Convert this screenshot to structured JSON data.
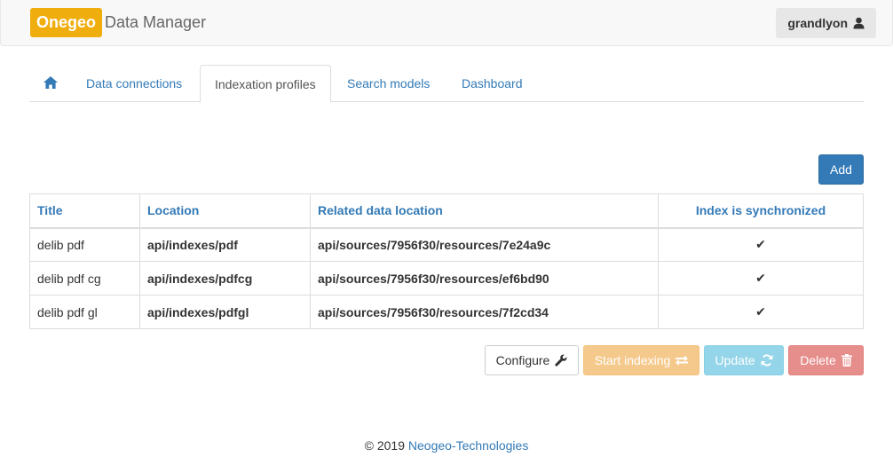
{
  "navbar": {
    "brand": "Onegeo",
    "app_title": "Data Manager",
    "user": "grandlyon",
    "user_icon": "user-icon"
  },
  "tabs": [
    {
      "label": "",
      "icon": "home-icon",
      "active": false
    },
    {
      "label": "Data connections",
      "active": false
    },
    {
      "label": "Indexation profiles",
      "active": true
    },
    {
      "label": "Search models",
      "active": false
    },
    {
      "label": "Dashboard",
      "active": false
    }
  ],
  "toolbar": {
    "add_label": "Add"
  },
  "table": {
    "headers": [
      "Title",
      "Location",
      "Related data location",
      "Index is synchronized"
    ],
    "rows": [
      {
        "title": "delib pdf",
        "location": "api/indexes/pdf",
        "related": "api/sources/7956f30/resources/7e24a9c",
        "synced": "✔"
      },
      {
        "title": "delib pdf cg",
        "location": "api/indexes/pdfcg",
        "related": "api/sources/7956f30/resources/ef6bd90",
        "synced": "✔"
      },
      {
        "title": "delib pdf gl",
        "location": "api/indexes/pdfgl",
        "related": "api/sources/7956f30/resources/7f2cd34",
        "synced": "✔"
      }
    ]
  },
  "actions": {
    "configure": "Configure",
    "start_indexing": "Start indexing",
    "update": "Update",
    "delete": "Delete"
  },
  "footer": {
    "copyright": "© 2019",
    "company": "Neogeo-Technologies"
  },
  "colors": {
    "brand": "#f0ad0e",
    "primary": "#337ab7",
    "warning": "#f0ad4e",
    "info": "#5bc0de",
    "danger": "#d9534f"
  }
}
